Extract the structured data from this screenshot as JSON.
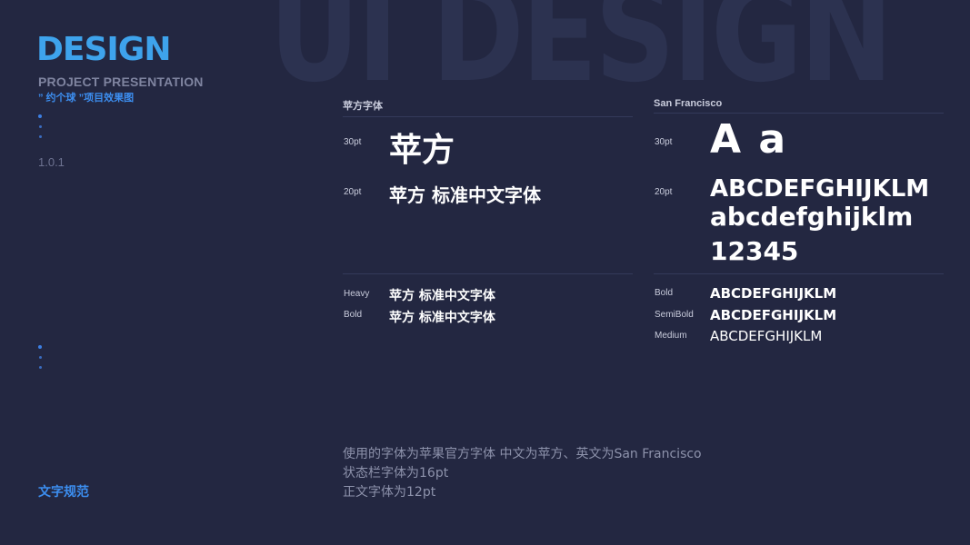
{
  "watermark": "UI DESIGN",
  "brand": {
    "title": "DESIGN",
    "subtitle": "PROJECT PRESENTATION",
    "tagline": "” 约个球 ”项目效果图",
    "version": "1.0.1",
    "section": "文字规范"
  },
  "left_column": {
    "header": "苹方字体",
    "size_30_label": "30pt",
    "size_30_sample": "苹方",
    "size_20_label": "20pt",
    "size_20_sample": "苹方 标准中文字体",
    "weights": [
      {
        "label": "Heavy",
        "sample": "苹方 标准中文字体"
      },
      {
        "label": "Bold",
        "sample": "苹方 标准中文字体"
      }
    ]
  },
  "right_column": {
    "header": "San Francisco",
    "size_30_label": "30pt",
    "size_30_sample": "A a",
    "size_20_label": "20pt",
    "size_20_upper": "ABCDEFGHIJKLM",
    "size_20_lower": "abcdefghijklm",
    "size_20_digits": "12345",
    "weights": [
      {
        "label": "Bold",
        "sample": "ABCDEFGHIJKLM"
      },
      {
        "label": "SemiBold",
        "sample": "ABCDEFGHIJKLM"
      },
      {
        "label": "Medium",
        "sample": "ABCDEFGHIJKLM"
      }
    ]
  },
  "description": [
    "使用的字体为苹果官方字体 中文为苹方、英文为San Francisco",
    "状态栏字体为16pt",
    "正文字体为12pt"
  ],
  "colors": {
    "background": "#232741",
    "accent": "#3c8ef0",
    "brand": "#3ea3ec"
  }
}
